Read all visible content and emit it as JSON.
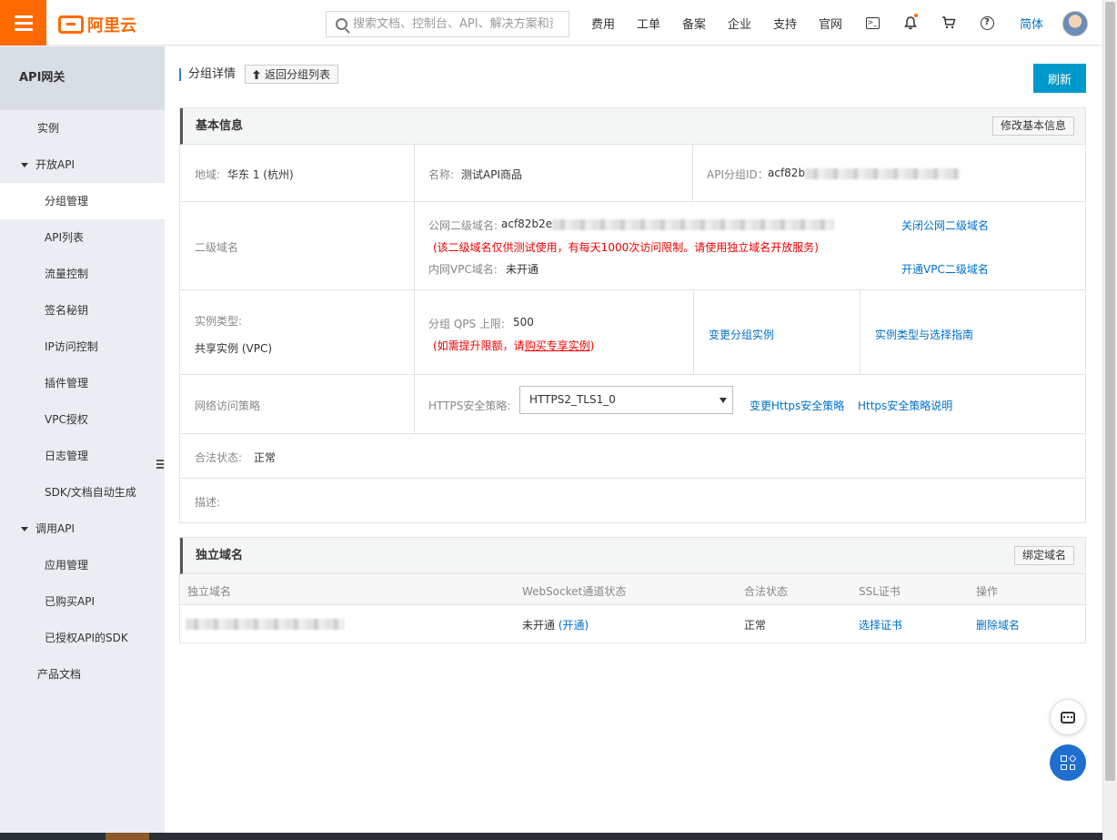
{
  "topbar": {
    "logo_text": "阿里云",
    "search_placeholder": "搜索文档、控制台、API、解决方案和资源",
    "nav": [
      "费用",
      "工单",
      "备案",
      "企业",
      "支持",
      "官网"
    ],
    "terminal_glyph": ">_",
    "help_glyph": "?",
    "lang": "简体"
  },
  "sidebar": {
    "title": "API网关",
    "items": [
      {
        "label": "实例",
        "type": "top"
      },
      {
        "label": "开放API",
        "type": "group"
      },
      {
        "label": "分组管理",
        "type": "sub",
        "active": true
      },
      {
        "label": "API列表",
        "type": "sub"
      },
      {
        "label": "流量控制",
        "type": "sub"
      },
      {
        "label": "签名秘钥",
        "type": "sub"
      },
      {
        "label": "IP访问控制",
        "type": "sub"
      },
      {
        "label": "插件管理",
        "type": "sub"
      },
      {
        "label": "VPC授权",
        "type": "sub"
      },
      {
        "label": "日志管理",
        "type": "sub"
      },
      {
        "label": "SDK/文档自动生成",
        "type": "sub"
      },
      {
        "label": "调用API",
        "type": "group"
      },
      {
        "label": "应用管理",
        "type": "sub"
      },
      {
        "label": "已购买API",
        "type": "sub"
      },
      {
        "label": "已授权API的SDK",
        "type": "sub"
      },
      {
        "label": "产品文档",
        "type": "top"
      }
    ]
  },
  "header": {
    "title": "分组详情",
    "back_label": "返回分组列表",
    "refresh_label": "刷新"
  },
  "basic": {
    "title": "基本信息",
    "edit_label": "修改基本信息",
    "region_label": "地域:",
    "region_value": "华东 1 (杭州)",
    "name_label": "名称:",
    "name_value": "测试API商品",
    "group_id_label": "API分组ID：",
    "group_id_value": "acf82b",
    "subdomain_label": "二级域名",
    "public_domain_label": "公网二级域名:",
    "public_domain_value": "acf82b2e",
    "public_domain_note": "(该二级域名仅供测试使用，有每天1000次访问限制。请使用独立域名开放服务)",
    "close_public_link": "关闭公网二级域名",
    "vpc_domain_label": "内网VPC域名:",
    "vpc_domain_value": "未开通",
    "open_vpc_link": "开通VPC二级域名",
    "instance_type_label": "实例类型:",
    "instance_type_value": "共享实例 (VPC)",
    "qps_label": "分组 QPS 上限:",
    "qps_value": "500",
    "qps_note_prefix": "(如需提升限额，请",
    "qps_note_link": "购买专享实例",
    "qps_note_suffix": ")",
    "change_instance_link": "变更分组实例",
    "instance_guide_link": "实例类型与选择指南",
    "network_policy_label": "网络访问策略",
    "https_policy_label": "HTTPS安全策略:",
    "https_policy_value": "HTTPS2_TLS1_0",
    "change_https_link": "变更Https安全策略",
    "https_doc_link": "Https安全策略说明",
    "legal_status_label": "合法状态:",
    "legal_status_value": "正常",
    "desc_label": "描述:"
  },
  "domains": {
    "title": "独立域名",
    "bind_label": "绑定域名",
    "columns": [
      "独立域名",
      "WebSocket通道状态",
      "合法状态",
      "SSL证书",
      "操作"
    ],
    "row": {
      "websocket_status": "未开通",
      "websocket_action": "(开通)",
      "legal_status": "正常",
      "ssl_action": "选择证书",
      "delete_action": "删除域名"
    }
  }
}
